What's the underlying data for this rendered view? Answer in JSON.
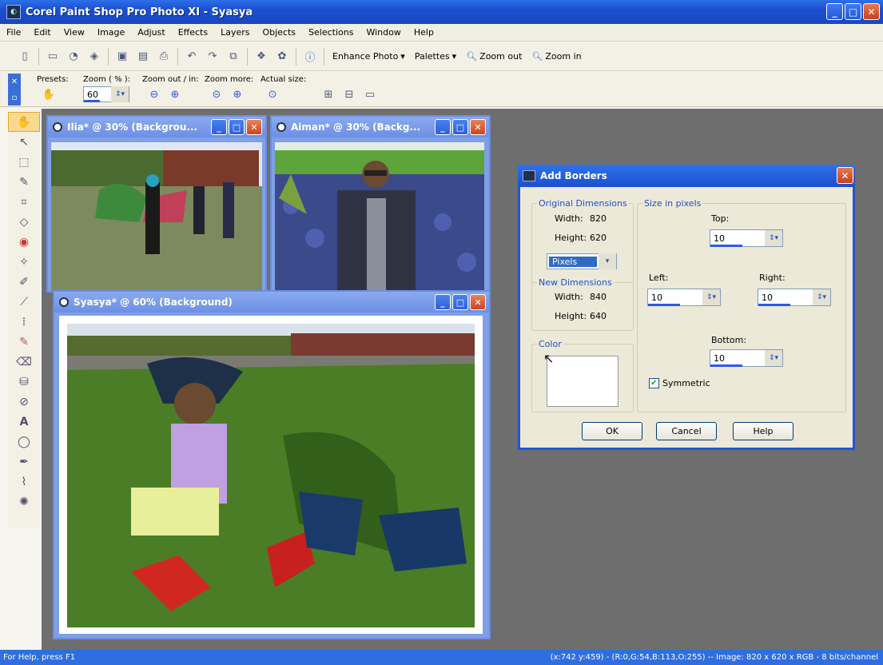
{
  "window": {
    "title": "Corel Paint Shop Pro Photo XI - Syasya"
  },
  "menu": [
    "File",
    "Edit",
    "View",
    "Image",
    "Adjust",
    "Effects",
    "Layers",
    "Objects",
    "Selections",
    "Window",
    "Help"
  ],
  "toolbar1": {
    "enhance_photo": "Enhance Photo",
    "palettes": "Palettes",
    "zoom_out": "Zoom out",
    "zoom_in": "Zoom in"
  },
  "toolbar2": {
    "presets": "Presets:",
    "zoom_pct": "Zoom ( % ):",
    "zoom_value": "60",
    "zoom_out_in": "Zoom out / in:",
    "zoom_more": "Zoom more:",
    "actual_size": "Actual size:"
  },
  "docs": [
    {
      "title": "Ilia* @  30% (Backgrou..."
    },
    {
      "title": "Aiman* @  30% (Backg..."
    },
    {
      "title": "Syasya* @  60% (Background)"
    }
  ],
  "dialog": {
    "title": "Add Borders",
    "original_dimensions": "Original Dimensions",
    "orig_width_label": "Width:",
    "orig_width": "820",
    "orig_height_label": "Height:",
    "orig_height": "620",
    "units": "Pixels",
    "new_dimensions": "New Dimensions",
    "new_width_label": "Width:",
    "new_width": "840",
    "new_height_label": "Height:",
    "new_height": "640",
    "color": "Color",
    "size_in_pixels": "Size in pixels",
    "top_label": "Top:",
    "top": "10",
    "left_label": "Left:",
    "left": "10",
    "right_label": "Right:",
    "right": "10",
    "bottom_label": "Bottom:",
    "bottom": "10",
    "symmetric": "Symmetric",
    "ok": "OK",
    "cancel": "Cancel",
    "help": "Help"
  },
  "status": {
    "left": "For Help, press F1",
    "right": "(x:742 y:459) - (R:0,G:54,B:113,O:255) -- Image:  820 x 620 x RGB - 8 bits/channel"
  }
}
